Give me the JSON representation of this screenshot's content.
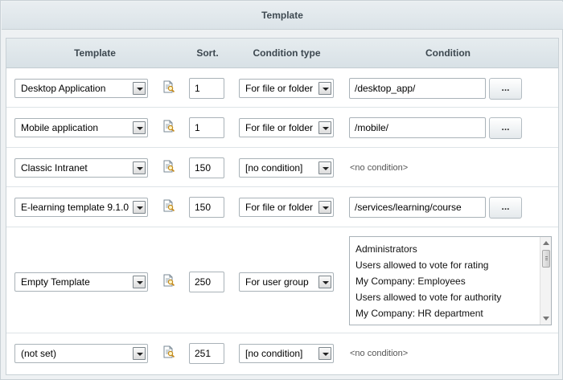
{
  "window": {
    "title": "Template"
  },
  "columns": {
    "template": "Template",
    "sort": "Sort.",
    "condition_type": "Condition type",
    "condition": "Condition"
  },
  "button_label": "...",
  "no_condition": "<no condition>",
  "rows": [
    {
      "template": "Desktop Application",
      "sort": "1",
      "condition_type": "For file or folder",
      "condition": "/desktop_app/"
    },
    {
      "template": "Mobile application",
      "sort": "1",
      "condition_type": "For file or folder",
      "condition": "/mobile/"
    },
    {
      "template": "Classic Intranet",
      "sort": "150",
      "condition_type": "[no condition]",
      "condition": "<no condition>"
    },
    {
      "template": "E-learning template 9.1.0",
      "sort": "150",
      "condition_type": "For file or folder",
      "condition": "/services/learning/course"
    },
    {
      "template": "Empty Template",
      "sort": "250",
      "condition_type": "For user group",
      "groups": [
        "Administrators",
        "Users allowed to vote for rating",
        "My Company: Employees",
        "Users allowed to vote for authority",
        "My Company: HR department"
      ]
    },
    {
      "template": "(not set)",
      "sort": "251",
      "condition_type": "[no condition]",
      "condition": "<no condition>"
    }
  ],
  "icons": {
    "edit": "edit-template-icon",
    "dropdown": "chevron-down-icon"
  },
  "colors": {
    "header_bg": "#dbe3e8",
    "border": "#c9d1d6",
    "title_text": "#3f4a52"
  }
}
